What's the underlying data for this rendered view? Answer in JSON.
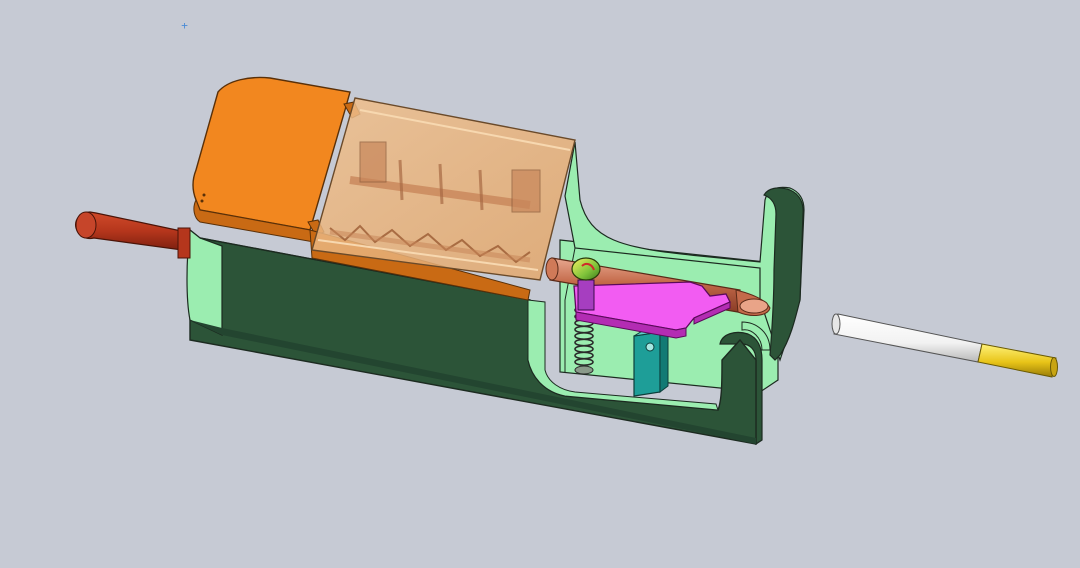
{
  "viewport": {
    "background": "#c6cad4",
    "origin_marker": "+"
  },
  "colors": {
    "orange": "#f2871f",
    "orange_dark": "#c96a14",
    "body_light": "#9bedb0",
    "body_dark": "#2c5438",
    "body_mid": "#4e8a5f",
    "handle": "#b5361c",
    "handle_dark": "#7e2010",
    "window": "#e8b27a",
    "copper": "#c46a4a",
    "magenta": "#f25cf2",
    "teal": "#1e9e98",
    "purple": "#a63ec0",
    "filter": "#f0d020",
    "paper": "#f8f8f8"
  },
  "model": {
    "parts": [
      "crank-handle",
      "hopper-lid",
      "transparent-window",
      "housing",
      "tube",
      "lever-arm",
      "spring",
      "support-post",
      "knob",
      "cigarette"
    ]
  }
}
